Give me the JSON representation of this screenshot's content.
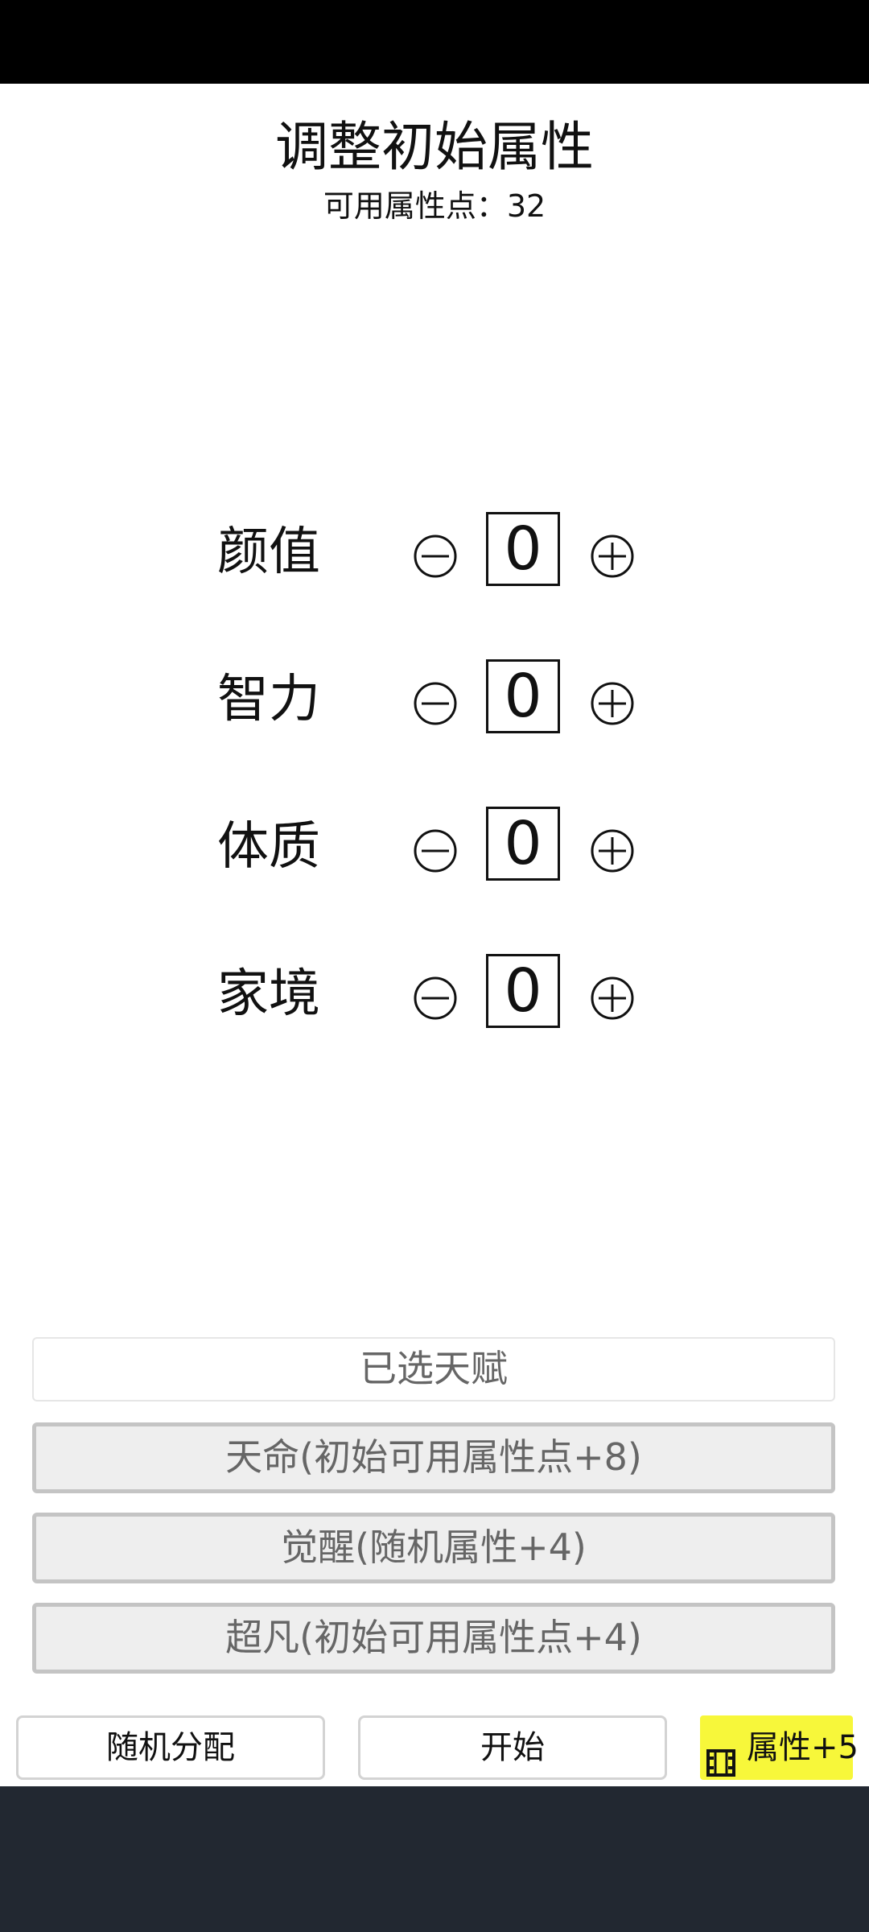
{
  "header": {
    "title": "调整初始属性",
    "available_points_label": "可用属性点：32"
  },
  "attributes": [
    {
      "label": "颜值",
      "value": "0"
    },
    {
      "label": "智力",
      "value": "0"
    },
    {
      "label": "体质",
      "value": "0"
    },
    {
      "label": "家境",
      "value": "0"
    }
  ],
  "talents": {
    "header": "已选天赋",
    "items": [
      {
        "label": "天命(初始可用属性点+8)"
      },
      {
        "label": "觉醒(随机属性+4)"
      },
      {
        "label": "超凡(初始可用属性点+4)"
      }
    ]
  },
  "actions": {
    "random_label": "随机分配",
    "start_label": "开始",
    "ad_label": "属性+5",
    "ad_icon": "video-film-icon"
  },
  "icons": {
    "decrease": "minus-circle-icon",
    "increase": "plus-circle-icon"
  },
  "colors": {
    "status_bar": "#000000",
    "nav_bar": "#222831",
    "ad_button": "#f7f73a",
    "talent_item_bg": "#eeeeee",
    "talent_item_border": "#c4c4c4"
  }
}
